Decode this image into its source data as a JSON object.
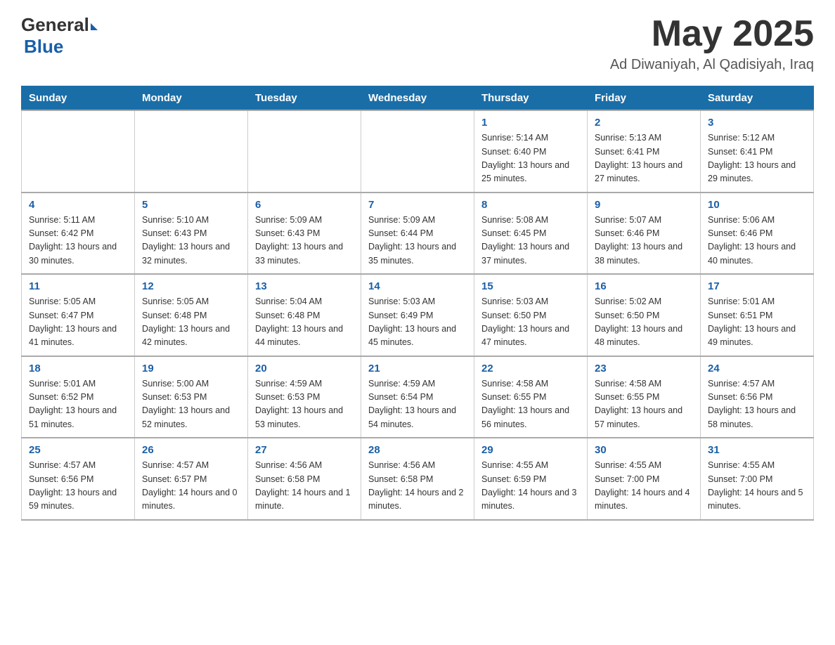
{
  "header": {
    "logo_general": "General",
    "logo_blue": "Blue",
    "month_title": "May 2025",
    "location": "Ad Diwaniyah, Al Qadisiyah, Iraq"
  },
  "days_of_week": [
    "Sunday",
    "Monday",
    "Tuesday",
    "Wednesday",
    "Thursday",
    "Friday",
    "Saturday"
  ],
  "weeks": [
    [
      {
        "day": "",
        "info": ""
      },
      {
        "day": "",
        "info": ""
      },
      {
        "day": "",
        "info": ""
      },
      {
        "day": "",
        "info": ""
      },
      {
        "day": "1",
        "info": "Sunrise: 5:14 AM\nSunset: 6:40 PM\nDaylight: 13 hours and 25 minutes."
      },
      {
        "day": "2",
        "info": "Sunrise: 5:13 AM\nSunset: 6:41 PM\nDaylight: 13 hours and 27 minutes."
      },
      {
        "day": "3",
        "info": "Sunrise: 5:12 AM\nSunset: 6:41 PM\nDaylight: 13 hours and 29 minutes."
      }
    ],
    [
      {
        "day": "4",
        "info": "Sunrise: 5:11 AM\nSunset: 6:42 PM\nDaylight: 13 hours and 30 minutes."
      },
      {
        "day": "5",
        "info": "Sunrise: 5:10 AM\nSunset: 6:43 PM\nDaylight: 13 hours and 32 minutes."
      },
      {
        "day": "6",
        "info": "Sunrise: 5:09 AM\nSunset: 6:43 PM\nDaylight: 13 hours and 33 minutes."
      },
      {
        "day": "7",
        "info": "Sunrise: 5:09 AM\nSunset: 6:44 PM\nDaylight: 13 hours and 35 minutes."
      },
      {
        "day": "8",
        "info": "Sunrise: 5:08 AM\nSunset: 6:45 PM\nDaylight: 13 hours and 37 minutes."
      },
      {
        "day": "9",
        "info": "Sunrise: 5:07 AM\nSunset: 6:46 PM\nDaylight: 13 hours and 38 minutes."
      },
      {
        "day": "10",
        "info": "Sunrise: 5:06 AM\nSunset: 6:46 PM\nDaylight: 13 hours and 40 minutes."
      }
    ],
    [
      {
        "day": "11",
        "info": "Sunrise: 5:05 AM\nSunset: 6:47 PM\nDaylight: 13 hours and 41 minutes."
      },
      {
        "day": "12",
        "info": "Sunrise: 5:05 AM\nSunset: 6:48 PM\nDaylight: 13 hours and 42 minutes."
      },
      {
        "day": "13",
        "info": "Sunrise: 5:04 AM\nSunset: 6:48 PM\nDaylight: 13 hours and 44 minutes."
      },
      {
        "day": "14",
        "info": "Sunrise: 5:03 AM\nSunset: 6:49 PM\nDaylight: 13 hours and 45 minutes."
      },
      {
        "day": "15",
        "info": "Sunrise: 5:03 AM\nSunset: 6:50 PM\nDaylight: 13 hours and 47 minutes."
      },
      {
        "day": "16",
        "info": "Sunrise: 5:02 AM\nSunset: 6:50 PM\nDaylight: 13 hours and 48 minutes."
      },
      {
        "day": "17",
        "info": "Sunrise: 5:01 AM\nSunset: 6:51 PM\nDaylight: 13 hours and 49 minutes."
      }
    ],
    [
      {
        "day": "18",
        "info": "Sunrise: 5:01 AM\nSunset: 6:52 PM\nDaylight: 13 hours and 51 minutes."
      },
      {
        "day": "19",
        "info": "Sunrise: 5:00 AM\nSunset: 6:53 PM\nDaylight: 13 hours and 52 minutes."
      },
      {
        "day": "20",
        "info": "Sunrise: 4:59 AM\nSunset: 6:53 PM\nDaylight: 13 hours and 53 minutes."
      },
      {
        "day": "21",
        "info": "Sunrise: 4:59 AM\nSunset: 6:54 PM\nDaylight: 13 hours and 54 minutes."
      },
      {
        "day": "22",
        "info": "Sunrise: 4:58 AM\nSunset: 6:55 PM\nDaylight: 13 hours and 56 minutes."
      },
      {
        "day": "23",
        "info": "Sunrise: 4:58 AM\nSunset: 6:55 PM\nDaylight: 13 hours and 57 minutes."
      },
      {
        "day": "24",
        "info": "Sunrise: 4:57 AM\nSunset: 6:56 PM\nDaylight: 13 hours and 58 minutes."
      }
    ],
    [
      {
        "day": "25",
        "info": "Sunrise: 4:57 AM\nSunset: 6:56 PM\nDaylight: 13 hours and 59 minutes."
      },
      {
        "day": "26",
        "info": "Sunrise: 4:57 AM\nSunset: 6:57 PM\nDaylight: 14 hours and 0 minutes."
      },
      {
        "day": "27",
        "info": "Sunrise: 4:56 AM\nSunset: 6:58 PM\nDaylight: 14 hours and 1 minute."
      },
      {
        "day": "28",
        "info": "Sunrise: 4:56 AM\nSunset: 6:58 PM\nDaylight: 14 hours and 2 minutes."
      },
      {
        "day": "29",
        "info": "Sunrise: 4:55 AM\nSunset: 6:59 PM\nDaylight: 14 hours and 3 minutes."
      },
      {
        "day": "30",
        "info": "Sunrise: 4:55 AM\nSunset: 7:00 PM\nDaylight: 14 hours and 4 minutes."
      },
      {
        "day": "31",
        "info": "Sunrise: 4:55 AM\nSunset: 7:00 PM\nDaylight: 14 hours and 5 minutes."
      }
    ]
  ]
}
